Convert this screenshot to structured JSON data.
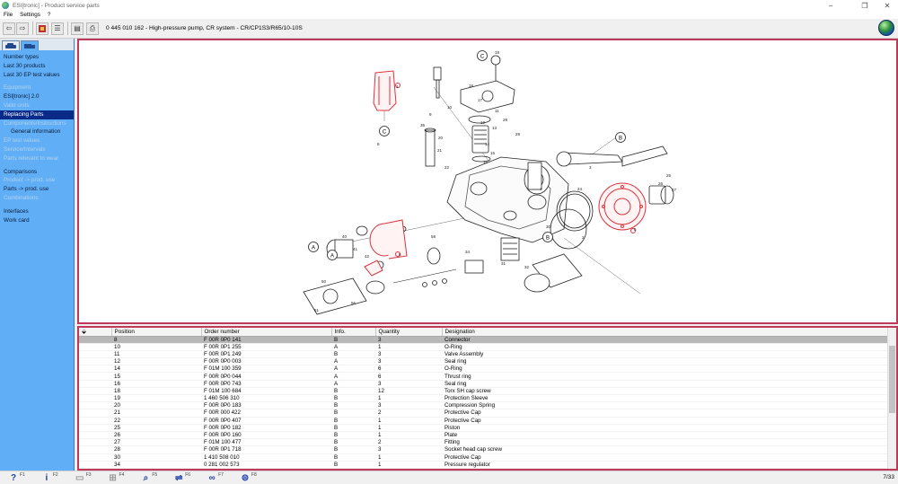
{
  "window": {
    "title": "ESI[tronic] - Product service parts",
    "controls": [
      "–",
      "❐",
      "✕"
    ]
  },
  "menu": [
    "File",
    "Settings",
    "?"
  ],
  "toolbar": {
    "doc_info": "0 445 010 162 - High-pressure pump, CR system - CR/CP1S3/R65/10-10S"
  },
  "sidebar": {
    "items": [
      {
        "label": "Number types",
        "state": "normal"
      },
      {
        "label": "Last 30 products",
        "state": "normal"
      },
      {
        "label": "Last 30 EP test values",
        "state": "normal"
      },
      {
        "label": "Equipment",
        "state": "dim"
      },
      {
        "label": "ESI[tronic] 2.0",
        "state": "normal"
      },
      {
        "label": "Valid units",
        "state": "dim"
      },
      {
        "label": "Replacing Parts",
        "state": "selected"
      },
      {
        "label": "Components/Instructions",
        "state": "dim"
      },
      {
        "label": "General information",
        "state": "indent"
      },
      {
        "label": "EP test values",
        "state": "dim"
      },
      {
        "label": "Service/Intervals",
        "state": "dim"
      },
      {
        "label": "Parts relevant to wear",
        "state": "dim"
      },
      {
        "label": "Comparisons",
        "state": "normal"
      },
      {
        "label": "Product -> prod. use",
        "state": "dim"
      },
      {
        "label": "Parts -> prod. use",
        "state": "normal"
      },
      {
        "label": "Combinations",
        "state": "dim"
      },
      {
        "label": "Interfaces",
        "state": "normal"
      },
      {
        "label": "Work card",
        "state": "normal"
      }
    ]
  },
  "drawing": {
    "callouts": [
      "B",
      "B",
      "A",
      "A",
      "C",
      "C"
    ],
    "part_numbers": [
      "1",
      "2",
      "3",
      "4",
      "5",
      "6",
      "8",
      "9",
      "10",
      "11",
      "12",
      "13",
      "14",
      "15",
      "16",
      "17",
      "18",
      "19",
      "20",
      "21",
      "22",
      "24",
      "25",
      "26",
      "27",
      "28",
      "29",
      "30",
      "31",
      "32",
      "34",
      "35",
      "40",
      "41",
      "42",
      "50",
      "51",
      "56",
      "58"
    ],
    "highlight_color": "#d9343e"
  },
  "parts_list": {
    "columns": [
      "",
      "Position",
      "Order number",
      "Info.",
      "Quantity",
      "Designation"
    ],
    "rows": [
      {
        "pos": "8",
        "order": "F 00R 0P0 141",
        "info": "B",
        "qty": "3",
        "desig": "Connector",
        "selected": true
      },
      {
        "pos": "10",
        "order": "F 00R 0P1 255",
        "info": "A",
        "qty": "1",
        "desig": "O-Ring"
      },
      {
        "pos": "11",
        "order": "F 00R 0P1 249",
        "info": "B",
        "qty": "3",
        "desig": "Valve Assembly"
      },
      {
        "pos": "12",
        "order": "F 00R 0P0 003",
        "info": "A",
        "qty": "3",
        "desig": "Seal ring"
      },
      {
        "pos": "14",
        "order": "F 01M 100 359",
        "info": "A",
        "qty": "6",
        "desig": "O-Ring"
      },
      {
        "pos": "15",
        "order": "F 00R 0P0 044",
        "info": "A",
        "qty": "6",
        "desig": "Thrust ring"
      },
      {
        "pos": "16",
        "order": "F 00R 0P0 743",
        "info": "A",
        "qty": "3",
        "desig": "Seal ring"
      },
      {
        "pos": "18",
        "order": "F 01M 100 684",
        "info": "B",
        "qty": "12",
        "desig": "Torx SH cap screw"
      },
      {
        "pos": "19",
        "order": "1 460 506 310",
        "info": "B",
        "qty": "1",
        "desig": "Protection Sleeve"
      },
      {
        "pos": "20",
        "order": "F 00R 0P0 183",
        "info": "B",
        "qty": "3",
        "desig": "Compression Spring"
      },
      {
        "pos": "21",
        "order": "F 00R 000 422",
        "info": "B",
        "qty": "2",
        "desig": "Protective Cap"
      },
      {
        "pos": "22",
        "order": "F 00R 0P0 407",
        "info": "B",
        "qty": "1",
        "desig": "Protective Cap"
      },
      {
        "pos": "25",
        "order": "F 00R 0P0 182",
        "info": "B",
        "qty": "1",
        "desig": "Piston"
      },
      {
        "pos": "26",
        "order": "F 00R 0P0 160",
        "info": "B",
        "qty": "1",
        "desig": "Plate"
      },
      {
        "pos": "27",
        "order": "F 01M 100 477",
        "info": "B",
        "qty": "2",
        "desig": "Fitting"
      },
      {
        "pos": "28",
        "order": "F 00R 0P1 718",
        "info": "B",
        "qty": "3",
        "desig": "Socket head cap screw"
      },
      {
        "pos": "30",
        "order": "1 410 508 010",
        "info": "B",
        "qty": "1",
        "desig": "Protective Cap"
      },
      {
        "pos": "34",
        "order": "0 281 002 573",
        "info": "B",
        "qty": "1",
        "desig": "Pressure regulator"
      }
    ]
  },
  "statusbar": {
    "buttons": [
      {
        "icon": "help-icon",
        "glyph": "?",
        "key": "F1",
        "enabled": true
      },
      {
        "icon": "info-icon",
        "glyph": "i",
        "key": "F2",
        "enabled": true
      },
      {
        "icon": "print-icon",
        "glyph": "▭",
        "key": "F3",
        "enabled": false
      },
      {
        "icon": "network-icon",
        "glyph": "⊞",
        "key": "F4",
        "enabled": false
      },
      {
        "icon": "zoom-icon",
        "glyph": "⌕",
        "key": "F5",
        "enabled": true
      },
      {
        "icon": "compare-icon",
        "glyph": "⇌",
        "key": "F6",
        "enabled": true
      },
      {
        "icon": "binoculars-icon",
        "glyph": "∞",
        "key": "F7",
        "enabled": true
      },
      {
        "icon": "cart-icon",
        "glyph": "⊜",
        "key": "F8",
        "enabled": true
      }
    ],
    "page_count": "7/33"
  }
}
